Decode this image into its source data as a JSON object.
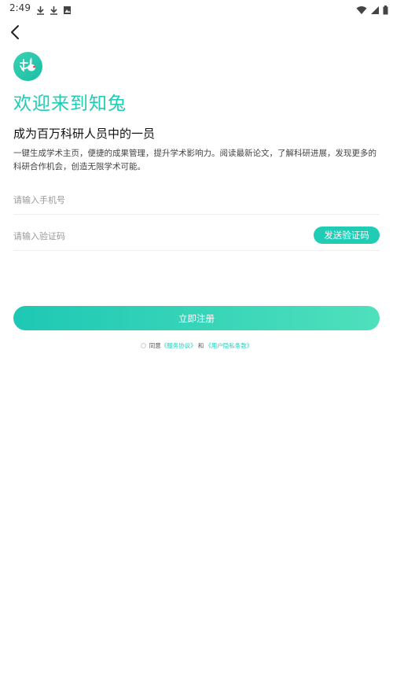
{
  "status_bar": {
    "time": "2:49",
    "icons": [
      "download-icon",
      "download-icon",
      "image-icon",
      "wifi-icon",
      "signal-icon",
      "battery-icon"
    ]
  },
  "header": {
    "back_icon": "chevron-left-icon"
  },
  "brand": {
    "logo_icon": "rabbit-logo-icon",
    "accent_color": "#20cdb4"
  },
  "content": {
    "welcome_title": "欢迎来到知兔",
    "subtitle": "成为百万科研人员中的一员",
    "description": "一键生成学术主页，便捷的成果管理，提升学术影响力。阅读最新论文，了解科研进展，发现更多的科研合作机会，创造无限学术可能。"
  },
  "form": {
    "phone_placeholder": "请输入手机号",
    "phone_value": "",
    "code_placeholder": "请输入验证码",
    "code_value": "",
    "send_code_label": "发送验证码",
    "register_label": "立即注册"
  },
  "agreement": {
    "prefix": "同意",
    "service_link": "《服务协议》",
    "conjunction": "和",
    "privacy_link": "《用户隐私条款》",
    "checked": false
  }
}
